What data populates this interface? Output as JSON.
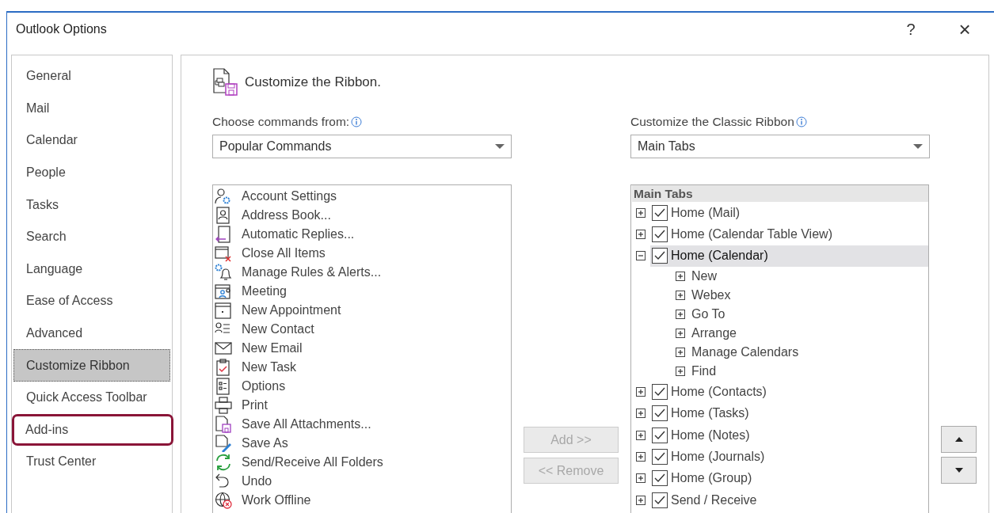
{
  "window": {
    "title": "Outlook Options",
    "help": "?",
    "close": "×"
  },
  "sidebar": {
    "items": [
      {
        "label": "General",
        "selected": false,
        "highlighted": false
      },
      {
        "label": "Mail",
        "selected": false,
        "highlighted": false
      },
      {
        "label": "Calendar",
        "selected": false,
        "highlighted": false
      },
      {
        "label": "People",
        "selected": false,
        "highlighted": false
      },
      {
        "label": "Tasks",
        "selected": false,
        "highlighted": false
      },
      {
        "label": "Search",
        "selected": false,
        "highlighted": false
      },
      {
        "label": "Language",
        "selected": false,
        "highlighted": false
      },
      {
        "label": "Ease of Access",
        "selected": false,
        "highlighted": false
      },
      {
        "label": "Advanced",
        "selected": false,
        "highlighted": false
      },
      {
        "label": "Customize Ribbon",
        "selected": true,
        "highlighted": false
      },
      {
        "label": "Quick Access Toolbar",
        "selected": false,
        "highlighted": false
      },
      {
        "label": "Add-ins",
        "selected": false,
        "highlighted": true
      },
      {
        "label": "Trust Center",
        "selected": false,
        "highlighted": false
      }
    ]
  },
  "heading": "Customize the Ribbon.",
  "commands": {
    "label": "Choose commands from:",
    "dropdown": {
      "value": "Popular Commands"
    },
    "items": [
      {
        "label": "Account Settings"
      },
      {
        "label": "Address Book..."
      },
      {
        "label": "Automatic Replies..."
      },
      {
        "label": "Close All Items"
      },
      {
        "label": "Manage Rules & Alerts..."
      },
      {
        "label": "Meeting"
      },
      {
        "label": "New Appointment"
      },
      {
        "label": "New Contact"
      },
      {
        "label": "New Email"
      },
      {
        "label": "New Task"
      },
      {
        "label": "Options"
      },
      {
        "label": "Print"
      },
      {
        "label": "Save All Attachments..."
      },
      {
        "label": "Save As"
      },
      {
        "label": "Send/Receive All Folders"
      },
      {
        "label": "Undo"
      },
      {
        "label": "Work Offline"
      }
    ]
  },
  "buttons": [
    {
      "label": "Add >>",
      "disabled": true
    },
    {
      "label": "<< Remove",
      "disabled": true
    }
  ],
  "ribbon": {
    "label": "Customize the Classic Ribbon",
    "dropdown": {
      "value": "Main Tabs"
    },
    "tree_header": "Main Tabs",
    "tree": [
      {
        "label": "Home (Mail)",
        "checked": true,
        "expanded": false,
        "selected": false
      },
      {
        "label": "Home (Calendar Table View)",
        "checked": true,
        "expanded": false,
        "selected": false
      },
      {
        "label": "Home (Calendar)",
        "checked": true,
        "expanded": true,
        "selected": true,
        "children": [
          {
            "label": "New",
            "expanded": false
          },
          {
            "label": "Webex",
            "expanded": false
          },
          {
            "label": "Go To",
            "expanded": false
          },
          {
            "label": "Arrange",
            "expanded": false
          },
          {
            "label": "Manage Calendars",
            "expanded": false
          },
          {
            "label": "Find",
            "expanded": false
          }
        ]
      },
      {
        "label": "Home (Contacts)",
        "checked": true,
        "expanded": false,
        "selected": false
      },
      {
        "label": "Home (Tasks)",
        "checked": true,
        "expanded": false,
        "selected": false
      },
      {
        "label": "Home (Notes)",
        "checked": true,
        "expanded": false,
        "selected": false
      },
      {
        "label": "Home (Journals)",
        "checked": true,
        "expanded": false,
        "selected": false
      },
      {
        "label": "Home (Group)",
        "checked": true,
        "expanded": false,
        "selected": false
      },
      {
        "label": "Send / Receive",
        "checked": true,
        "expanded": false,
        "selected": false
      }
    ]
  }
}
